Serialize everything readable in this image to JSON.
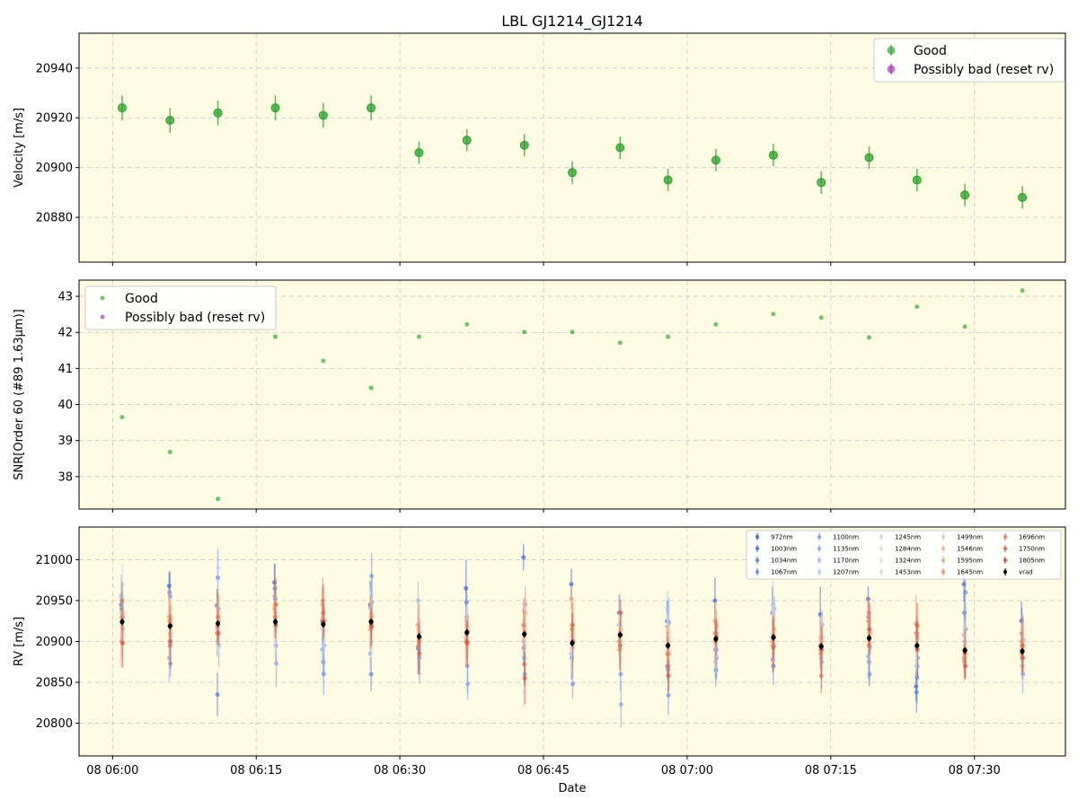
{
  "title": "LBL GJ1214_GJ1214",
  "colors": {
    "plot_bg": "#fdfbe1",
    "good": "#2ca02c",
    "possibly_bad": "#9b34a8",
    "grid": "#c8c8c8",
    "vrad": "#000000"
  },
  "x_axis": {
    "label": "Date",
    "tick_labels": [
      "08 06:00",
      "08 06:15",
      "08 06:30",
      "08 06:45",
      "08 07:00",
      "08 07:15",
      "08 07:30"
    ],
    "tick_minutes": [
      0,
      15,
      30,
      45,
      60,
      75,
      90
    ],
    "range_minutes": [
      -3.5,
      99.5
    ]
  },
  "chart_data": [
    {
      "type": "scatter",
      "name": "velocity",
      "ylabel": "Velocity [m/s]",
      "ylim": [
        20862,
        20954
      ],
      "yticks": [
        20880,
        20900,
        20920,
        20940
      ],
      "grid": true,
      "legend": "top-right",
      "legend_entries": [
        "Good",
        "Possibly bad (reset rv)"
      ],
      "x": [
        "06:01",
        "06:06",
        "06:11",
        "06:17",
        "06:22",
        "06:27",
        "06:32",
        "06:37",
        "06:43",
        "06:48",
        "06:53",
        "06:58",
        "07:03",
        "07:09",
        "07:14",
        "07:19",
        "07:24",
        "07:29",
        "07:35"
      ],
      "y": [
        20924,
        20919,
        20922,
        20924,
        20921,
        20924,
        20906,
        20911,
        20909,
        20898,
        20908,
        20895,
        20903,
        20905,
        20894,
        20904,
        20895,
        20889,
        20888
      ],
      "yerr": [
        5,
        5,
        5,
        5,
        5,
        5,
        4.5,
        4.5,
        4.5,
        4.5,
        4.5,
        4.5,
        4.5,
        4.5,
        4.5,
        4.5,
        4.5,
        4.5,
        4.5
      ]
    },
    {
      "type": "scatter",
      "name": "snr",
      "ylabel": "SNR[Order 60 (#89 1.63μm)]",
      "ylim": [
        37.1,
        43.45
      ],
      "yticks": [
        38,
        39,
        40,
        41,
        42,
        43
      ],
      "grid": true,
      "legend": "top-left",
      "legend_entries": [
        "Good",
        "Possibly bad (reset rv)"
      ],
      "x": [
        "06:01",
        "06:06",
        "06:11",
        "06:17",
        "06:22",
        "06:27",
        "06:32",
        "06:37",
        "06:43",
        "06:48",
        "06:53",
        "06:58",
        "07:03",
        "07:09",
        "07:14",
        "07:19",
        "07:24",
        "07:29",
        "07:35"
      ],
      "y": [
        39.65,
        38.68,
        37.38,
        41.88,
        41.21,
        40.46,
        41.88,
        42.22,
        42.01,
        42.01,
        41.71,
        41.88,
        42.22,
        42.51,
        42.41,
        41.86,
        42.71,
        42.16,
        43.16
      ]
    },
    {
      "type": "scatter",
      "name": "rv_per_band",
      "ylabel": "RV [m/s]",
      "ylim": [
        20760,
        21040
      ],
      "yticks": [
        20800,
        20850,
        20900,
        20950,
        21000
      ],
      "grid": true,
      "legend": "top-right",
      "bands": [
        "972nm",
        "1003nm",
        "1034nm",
        "1067nm",
        "1100nm",
        "1135nm",
        "1170nm",
        "1207nm",
        "1245nm",
        "1284nm",
        "1324nm",
        "1453nm",
        "1499nm",
        "1546nm",
        "1595nm",
        "1645nm",
        "1696nm",
        "1750nm",
        "1805nm",
        "vrad"
      ],
      "band_colors": [
        "#4a63d3",
        "#5573d9",
        "#6384e0",
        "#7294e6",
        "#84a4ea",
        "#95b3ee",
        "#a7c1f0",
        "#b9cef1",
        "#cad8f0",
        "#d9e0ed",
        "#e6e1df",
        "#eed6c7",
        "#f2c9b1",
        "#f3ba9c",
        "#f2a988",
        "#ee9674",
        "#e68263",
        "#dc6d54",
        "#cf5647",
        "#000000"
      ],
      "x": [
        "06:01",
        "06:06",
        "06:11",
        "06:17",
        "06:22",
        "06:27",
        "06:32",
        "06:37",
        "06:43",
        "06:48",
        "06:53",
        "06:58",
        "07:03",
        "07:09",
        "07:14",
        "07:19",
        "07:24",
        "07:29",
        "07:35"
      ],
      "vrad": [
        20924,
        20919,
        20922,
        20924,
        20921,
        20924,
        20906,
        20911,
        20909,
        20898,
        20908,
        20895,
        20903,
        20905,
        20894,
        20904,
        20895,
        20889,
        20888
      ],
      "band_values": [
        [
          20945,
          20968,
          20944,
          20972,
          20925,
          20945,
          20892,
          20965,
          21003,
          20970,
          20935,
          20925,
          20950,
          20935,
          20933,
          20952,
          20845,
          20970,
          20925
        ],
        [
          20940,
          20960,
          20835,
          20965,
          20930,
          20942,
          20895,
          20948,
          20892,
          20880,
          20900,
          20918,
          20890,
          20878,
          20905,
          20930,
          20838,
          20935,
          20910
        ],
        [
          20925,
          20955,
          20978,
          20952,
          20875,
          20860,
          20890,
          20930,
          20880,
          20892,
          20895,
          20866,
          20865,
          20870,
          20880,
          20875,
          20856,
          20900,
          20870
        ],
        [
          20915,
          20873,
          20940,
          20895,
          20860,
          20980,
          20880,
          20870,
          20860,
          20848,
          20860,
          20834,
          20880,
          20895,
          20875,
          20860,
          20870,
          20960,
          20860
        ],
        [
          20930,
          20920,
          20895,
          20873,
          20895,
          20948,
          20905,
          20848,
          20945,
          20900,
          20823,
          20923,
          20890,
          20940,
          20920,
          20892,
          20880,
          20915,
          20902
        ],
        [
          20955,
          20880,
          20915,
          20955,
          20890,
          20885,
          20950,
          20905,
          20900,
          20885,
          20920,
          20870,
          20910,
          20935,
          20890,
          20882,
          20892,
          20908,
          20890
        ],
        [
          20935,
          20900,
          20900,
          20935,
          20915,
          20940,
          20915,
          20925,
          20938,
          20880,
          20905,
          20940,
          20875,
          20945,
          20900,
          20915,
          20870,
          20878,
          20880
        ],
        [
          20910,
          20940,
          20990,
          20918,
          20905,
          20928,
          20900,
          20920,
          20925,
          20905,
          20932,
          20910,
          20895,
          20940,
          20895,
          20905,
          20905,
          20880,
          20895
        ],
        [
          20970,
          20915,
          20930,
          20920,
          20935,
          20900,
          20910,
          20915,
          20895,
          20895,
          20918,
          20890,
          20920,
          20915,
          20910,
          20898,
          20895,
          20890,
          20900
        ],
        [
          20900,
          20910,
          20905,
          20928,
          20915,
          20918,
          20900,
          20910,
          20905,
          20910,
          20912,
          20900,
          20905,
          20905,
          20895,
          20912,
          20895,
          20892,
          20892
        ],
        [
          20920,
          20935,
          20915,
          20925,
          20935,
          20930,
          20920,
          20895,
          20838,
          20905,
          20910,
          20905,
          20900,
          20910,
          20898,
          20908,
          20890,
          20885,
          20895
        ],
        [
          20905,
          20925,
          20920,
          20915,
          20930,
          20935,
          20915,
          20920,
          20915,
          20890,
          20905,
          20915,
          20910,
          20900,
          20905,
          20920,
          20900,
          20895,
          20890
        ],
        [
          20925,
          20910,
          20930,
          20935,
          20920,
          20925,
          20908,
          20905,
          20915,
          20905,
          20910,
          20905,
          20915,
          20910,
          20895,
          20905,
          20910,
          20880,
          20895
        ],
        [
          20915,
          20928,
          20935,
          20930,
          20940,
          20920,
          20912,
          20918,
          20912,
          20910,
          20915,
          20895,
          20918,
          20908,
          20900,
          20900,
          20905,
          20885,
          20890
        ],
        [
          20935,
          20920,
          20925,
          20945,
          20925,
          20930,
          20905,
          20912,
          20935,
          20920,
          20908,
          20885,
          20920,
          20915,
          20905,
          20910,
          20918,
          20890,
          20895
        ],
        [
          20900,
          20930,
          20910,
          20940,
          20945,
          20915,
          20920,
          20900,
          20920,
          20952,
          20900,
          20895,
          20925,
          20900,
          20895,
          20925,
          20922,
          20880,
          20900
        ],
        [
          20930,
          20925,
          20918,
          20930,
          20950,
          20925,
          20895,
          20910,
          20920,
          20915,
          20890,
          20885,
          20900,
          20895,
          20885,
          20935,
          20910,
          20875,
          20885
        ],
        [
          20950,
          20895,
          20930,
          20945,
          20935,
          20920,
          20900,
          20900,
          20872,
          20920,
          20895,
          20870,
          20910,
          20892,
          20858,
          20895,
          20920,
          20885,
          20895
        ],
        [
          20898,
          20900,
          20910,
          20920,
          20925,
          20918,
          20885,
          20898,
          20855,
          20900,
          20935,
          20858,
          20905,
          20905,
          20890,
          20915,
          20890,
          20870,
          20880
        ],
        [
          20924,
          20919,
          20922,
          20924,
          20921,
          20924,
          20906,
          20911,
          20909,
          20898,
          20908,
          20895,
          20903,
          20905,
          20894,
          20904,
          20895,
          20889,
          20888
        ]
      ]
    }
  ]
}
